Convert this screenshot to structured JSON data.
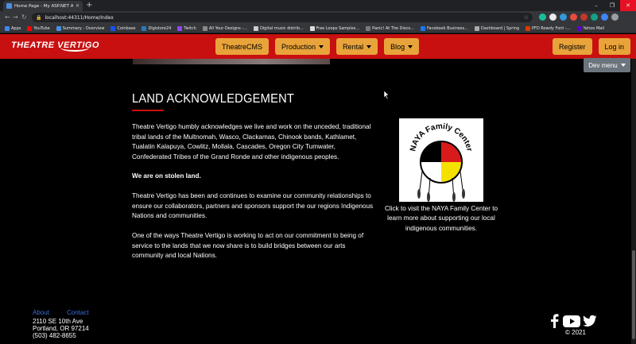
{
  "browser": {
    "tab_title": "Home Page - My ASP.NET Appli...",
    "new_tab": "+",
    "url": "localhost:44311/Home/Index",
    "bookmarks": [
      {
        "label": "Apps",
        "color": "#4285f4"
      },
      {
        "label": "YouTube",
        "color": "#ff0000"
      },
      {
        "label": "Summary - Overview",
        "color": "#4a90e2"
      },
      {
        "label": "Coinbase",
        "color": "#1652f0"
      },
      {
        "label": "Digistore24",
        "color": "#2a7ab9"
      },
      {
        "label": "Twitch",
        "color": "#9146ff"
      },
      {
        "label": "All Your Designs -...",
        "color": "#888888"
      },
      {
        "label": "Digital music distrib...",
        "color": "#cccccc"
      },
      {
        "label": "Free Loops Samples...",
        "color": "#dddddd"
      },
      {
        "label": "Panic! At The Disco...",
        "color": "#7a7a7a"
      },
      {
        "label": "Facebook Business...",
        "color": "#1877f2"
      },
      {
        "label": "Dashboard | Spring",
        "color": "#aaaaaa"
      },
      {
        "label": "PFD Rowdy Font -...",
        "color": "#d83b01"
      },
      {
        "label": "Yahoo Mail",
        "color": "#6001d2"
      }
    ],
    "extension_colors": [
      "#1abc9c",
      "#e8eaed",
      "#3498db",
      "#e74c3c",
      "#c0392b",
      "#16a085",
      "#4285f4",
      "#9aa0a6"
    ]
  },
  "header": {
    "brand": "THEATRE VERTIGO",
    "nav": [
      {
        "label": "TheatreCMS",
        "dropdown": false
      },
      {
        "label": "Production",
        "dropdown": true
      },
      {
        "label": "Rental",
        "dropdown": true
      },
      {
        "label": "Blog",
        "dropdown": true
      }
    ],
    "auth": {
      "register": "Register",
      "login": "Log in"
    },
    "dev_menu": "Dev menu"
  },
  "content": {
    "title": "LAND ACKNOWLEDGEMENT",
    "paragraphs": [
      "Theatre Vertigo humbly acknowledges we live and work on the unceded, traditional tribal lands of the Multnomah, Wasco, Clackamas, Chinook bands, Kathlamet, Tualatin Kalapuya, Cowlitz, Mollala, Cascades, Oregon City Tumwater, Confederated Tribes of the Grand Ronde and other indigenous peoples.",
      "We are on stolen land.",
      "Theatre Vertigo has been and continues to examine our community relationships to ensure our collaborators, partners and sponsors support the our regions Indigenous Nations and communities.",
      "One of the ways Theatre Vertigo is working to act on our commitment to being of service to the lands that we now share is to build bridges between our arts community and local Nations."
    ],
    "logo_text": "NAYA Family Center",
    "logo_caption": "Click to visit the NAYA Family Center to learn more about supporting our local indigenous communities."
  },
  "footer": {
    "links": [
      "About",
      "Contact"
    ],
    "address": [
      "2110 SE 10th Ave",
      "Portland, OR 97214",
      "(503) 482-8655"
    ],
    "social_icons": [
      "facebook-icon",
      "youtube-icon",
      "twitter-icon"
    ],
    "copyright": "© 2021"
  }
}
